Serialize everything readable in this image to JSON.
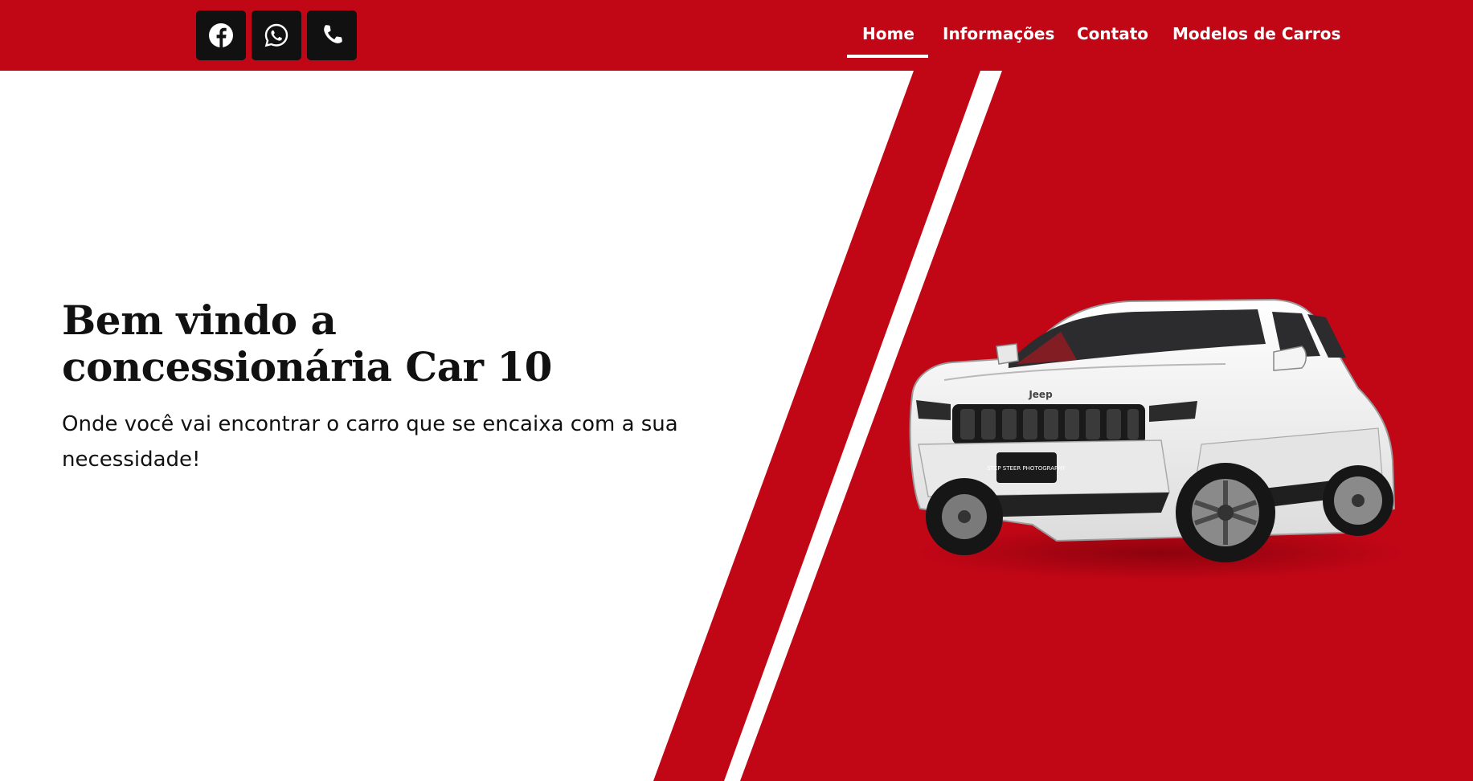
{
  "header": {
    "social": [
      {
        "icon": "facebook-icon"
      },
      {
        "icon": "whatsapp-icon"
      },
      {
        "icon": "phone-icon"
      }
    ],
    "nav": [
      {
        "label": "Home",
        "active": true
      },
      {
        "label": "Informações"
      },
      {
        "label": "Contato"
      },
      {
        "label": "Modelos de Carros"
      }
    ]
  },
  "hero": {
    "title_line1": "Bem vindo a",
    "title_line2": "concessionária Car 10",
    "subtitle_line1": "Onde você vai encontrar o carro que se encaixa com a sua",
    "subtitle_line2": "necessidade!",
    "car_image": "white-suv-jeep",
    "plate_text": "STEP STEER PHOTOGRAPHY",
    "grille_brand": "Jeep"
  },
  "colors": {
    "brand_red": "#c10616",
    "dark": "#111111",
    "white": "#ffffff"
  }
}
